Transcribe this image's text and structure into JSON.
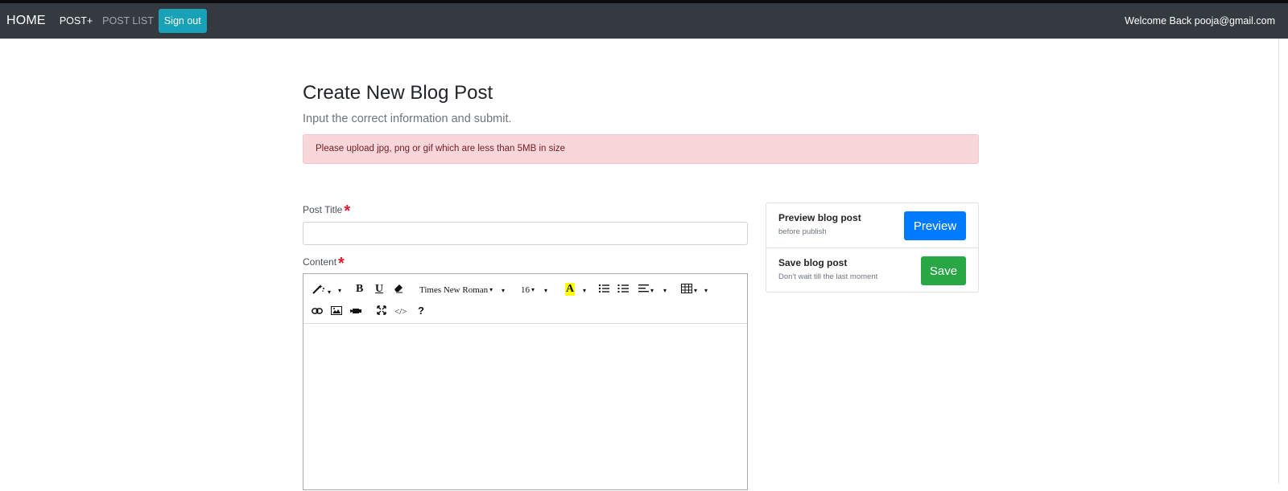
{
  "navbar": {
    "brand": "HOME",
    "links": [
      {
        "label": "POST+"
      },
      {
        "label": "POST LIST"
      }
    ],
    "signout_label": "Sign out",
    "welcome": "Welcome Back pooja@gmail.com"
  },
  "page": {
    "title": "Create New Blog Post",
    "lead": "Input the correct information and submit.",
    "alert": "Please upload jpg, png or gif which are less than 5MB in size"
  },
  "form": {
    "title_label": "Post Title",
    "title_value": "",
    "content_label": "Content",
    "required_mark": "*"
  },
  "editor": {
    "font_name": "Times New Roman",
    "font_size": "16",
    "bold": "B",
    "underline": "U",
    "highlight": "A",
    "code": "</>",
    "help": "?",
    "caret": "▾"
  },
  "sidebar": {
    "preview_title": "Preview blog post",
    "preview_sub": "before publish",
    "preview_button": "Preview",
    "save_title": "Save blog post",
    "save_sub": "Don't wait till the last moment",
    "save_button": "Save"
  },
  "colors": {
    "navbar": "#343a40",
    "signout": "#17a2b8",
    "alert_bg": "#f8d7da",
    "preview": "#007bff",
    "save": "#28a745",
    "required": "#e3192b"
  }
}
